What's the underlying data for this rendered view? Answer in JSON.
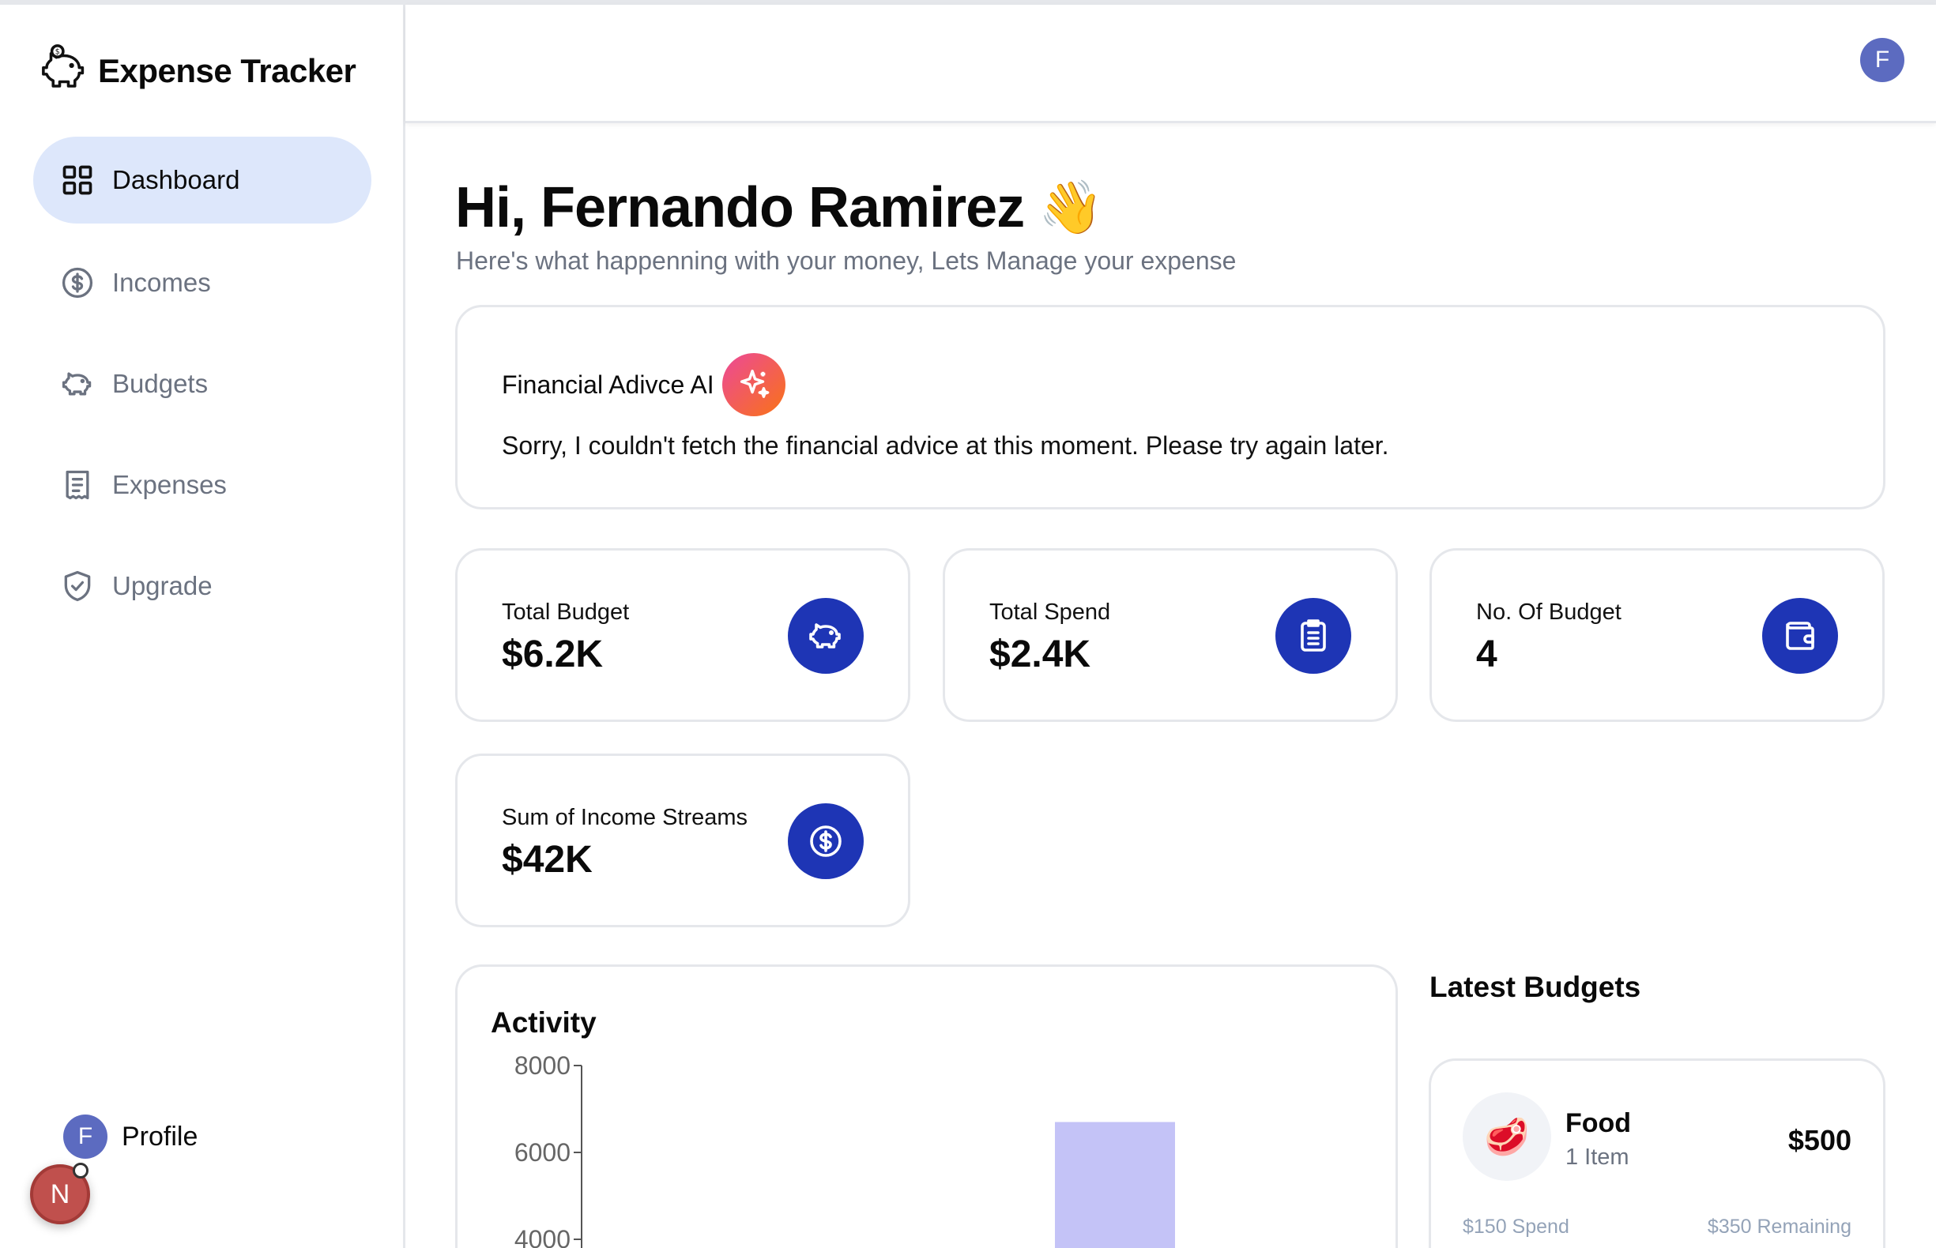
{
  "app": {
    "title": "Expense Tracker"
  },
  "sidebar": {
    "items": [
      {
        "label": "Dashboard",
        "icon": "dashboard-grid-icon",
        "active": true
      },
      {
        "label": "Incomes",
        "icon": "dollar-circle-icon"
      },
      {
        "label": "Budgets",
        "icon": "piggy-bank-icon"
      },
      {
        "label": "Expenses",
        "icon": "receipt-icon"
      },
      {
        "label": "Upgrade",
        "icon": "shield-check-icon"
      }
    ],
    "profile": {
      "label": "Profile",
      "avatar_initial": "F"
    },
    "dev_badge": "N"
  },
  "header": {
    "avatar_initial": "F"
  },
  "greeting": {
    "title": "Hi, Fernando Ramirez",
    "emoji": "👋",
    "subtitle": "Here's what happenning with your money, Lets Manage your expense"
  },
  "ai_card": {
    "title": "Financial Adivce AI",
    "message": "Sorry, I couldn't fetch the financial advice at this moment. Please try again later."
  },
  "stats": [
    {
      "label": "Total Budget",
      "value": "$6.2K",
      "icon": "piggy-bank-icon"
    },
    {
      "label": "Total Spend",
      "value": "$2.4K",
      "icon": "receipt-icon"
    },
    {
      "label": "No. Of Budget",
      "value": "4",
      "icon": "wallet-icon"
    },
    {
      "label": "Sum of Income Streams",
      "value": "$42K",
      "icon": "dollar-circle-icon"
    }
  ],
  "activity": {
    "title": "Activity",
    "chart_data": {
      "type": "bar",
      "title": "Activity",
      "yticks": [
        8000,
        6000,
        4000
      ],
      "ylim_visible": [
        3600,
        8200
      ],
      "bar_color": "#c4c3f7",
      "values": [
        6700
      ]
    }
  },
  "latest_budgets": {
    "title": "Latest Budgets",
    "items": [
      {
        "emoji": "🥩",
        "name": "Food",
        "items": "1 Item",
        "amount": "$500",
        "spend": "$150 Spend",
        "remaining": "$350 Remaining"
      }
    ]
  },
  "colors": {
    "accent": "#1e35b5",
    "active_nav": "#dde7fb",
    "avatar": "#5c6bc0",
    "bar": "#c4c3f7"
  }
}
